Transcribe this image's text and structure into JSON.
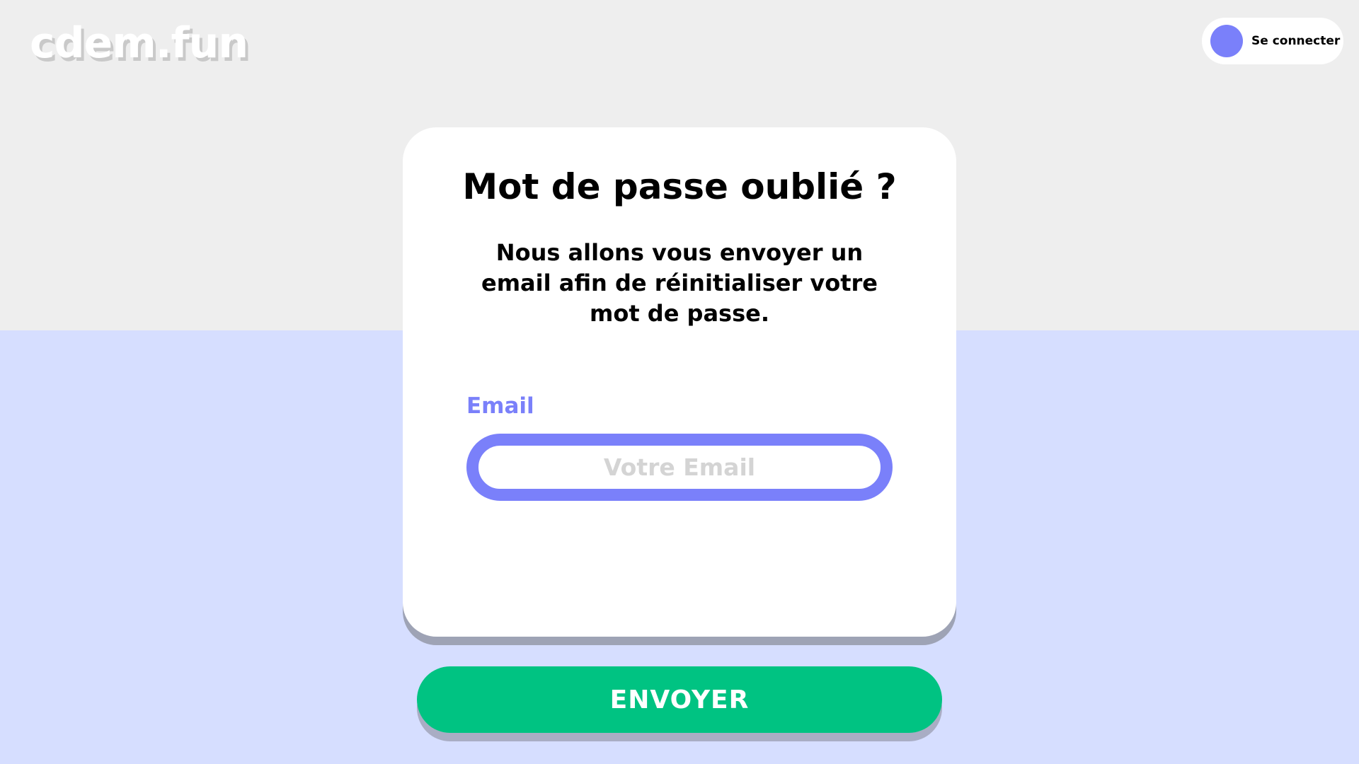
{
  "header": {
    "logo_text": "cdem.fun",
    "login": {
      "avatar_icon": "user-avatar-icon",
      "label": "Se connecter"
    }
  },
  "card": {
    "title": "Mot de passe oublié ?",
    "subtitle": "Nous allons vous envoyer un email afin de réinitialiser votre mot de passe.",
    "email": {
      "label": "Email",
      "value": "",
      "placeholder": "Votre Email"
    }
  },
  "actions": {
    "send_label": "ENVOYER"
  },
  "colors": {
    "background_top": "#eeeeee",
    "background_bottom": "#d6deff",
    "accent": "#7a80fa",
    "primary_button": "#00c382",
    "card": "#ffffff"
  }
}
